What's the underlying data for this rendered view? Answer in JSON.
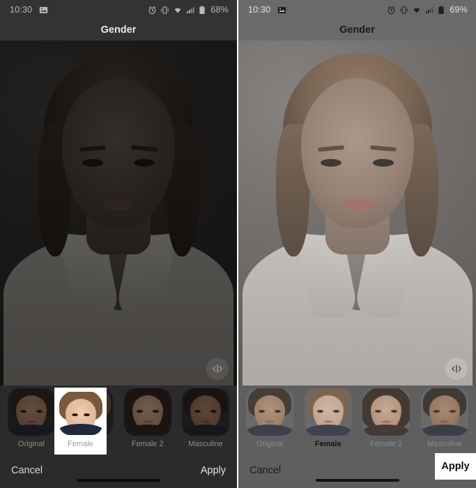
{
  "app": {
    "screen_title": "Gender"
  },
  "panels": [
    {
      "id": "before",
      "status_bar": {
        "time": "10:30",
        "left_icons": [
          "gallery-icon"
        ],
        "right_icons": [
          "alarm-icon",
          "vibrate-icon",
          "wifi-icon",
          "signal-icon",
          "battery-icon"
        ],
        "battery_percent": "68%"
      },
      "title": "Gender",
      "photo": {
        "subject": "portrait-before",
        "compare_icon": "compare-icon"
      },
      "thumbnails": [
        {
          "label": "Original",
          "selected": false,
          "face": "f-original"
        },
        {
          "label": "Female",
          "selected": true,
          "face": "f-female"
        },
        {
          "label": "Female 2",
          "selected": false,
          "face": "f-female2"
        },
        {
          "label": "Masculine",
          "selected": false,
          "face": "f-masculine"
        }
      ],
      "actions": {
        "cancel": "Cancel",
        "apply": "Apply"
      }
    },
    {
      "id": "after",
      "status_bar": {
        "time": "10:30",
        "left_icons": [
          "gallery-icon"
        ],
        "right_icons": [
          "alarm-icon",
          "vibrate-icon",
          "wifi-icon",
          "signal-icon",
          "battery-icon"
        ],
        "battery_percent": "69%"
      },
      "title": "Gender",
      "photo": {
        "subject": "portrait-after",
        "compare_icon": "compare-icon"
      },
      "thumbnails": [
        {
          "label": "Original",
          "selected": false,
          "face": "f-original"
        },
        {
          "label": "Female",
          "selected": true,
          "face": "f-female"
        },
        {
          "label": "Female 2",
          "selected": false,
          "face": "f-female2"
        },
        {
          "label": "Masculine",
          "selected": false,
          "face": "f-masculine"
        }
      ],
      "actions": {
        "cancel": "Cancel",
        "apply": "Apply"
      }
    }
  ],
  "highlights": [
    {
      "id": "female-thumb-highlight",
      "label": "Female",
      "target": "thumbnail"
    },
    {
      "id": "apply-button-highlight",
      "label": "Apply",
      "target": "apply-button"
    }
  ],
  "colors": {
    "panel_before_bg": "#2b2b2b",
    "panel_after_bg": "#5f5f5f",
    "highlight_box": "#ffffff",
    "divider": "#ffffff"
  }
}
